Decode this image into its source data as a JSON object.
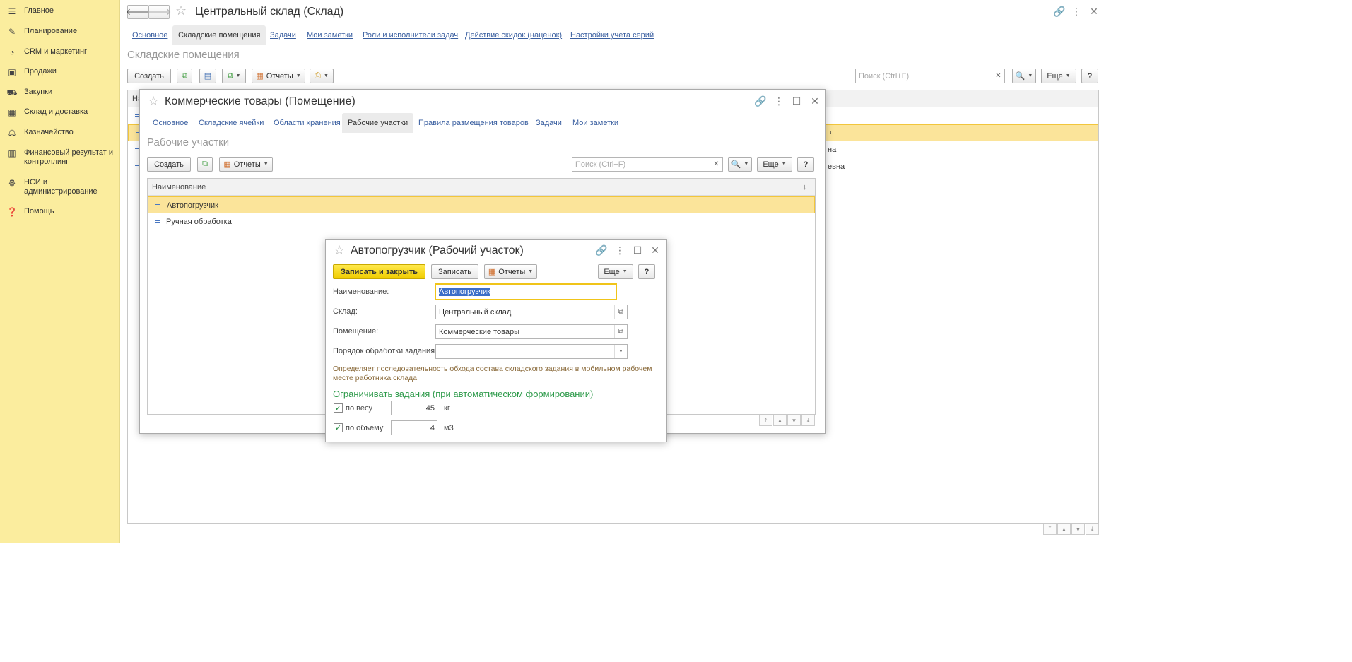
{
  "sidebar": {
    "items": [
      {
        "label": "Главное",
        "icon": "menu-icon"
      },
      {
        "label": "Планирование",
        "icon": "planning-icon"
      },
      {
        "label": "CRM и маркетинг",
        "icon": "crm-icon"
      },
      {
        "label": "Продажи",
        "icon": "sales-icon"
      },
      {
        "label": "Закупки",
        "icon": "cart-icon"
      },
      {
        "label": "Склад и доставка",
        "icon": "warehouse-icon"
      },
      {
        "label": "Казначейство",
        "icon": "treasury-icon"
      },
      {
        "label": "Финансовый результат и контроллинг",
        "icon": "chart-icon"
      },
      {
        "label": "НСИ и администрирование",
        "icon": "gear-icon"
      },
      {
        "label": "Помощь",
        "icon": "help-icon"
      }
    ]
  },
  "main": {
    "title": "Центральный склад (Склад)",
    "tabs": [
      "Основное",
      "Складские помещения",
      "Задачи",
      "Мои заметки",
      "Роли и исполнители задач",
      "Действие скидок (наценок)",
      "Настройки учета серий"
    ],
    "active_tab": "Складские помещения",
    "section_title": "Складские помещения",
    "toolbar": {
      "create": "Создать",
      "reports": "Отчеты",
      "more": "Еще",
      "help": "?"
    },
    "search_placeholder": "Поиск (Ctrl+F)",
    "grid": {
      "header_partial": "На",
      "row_fragments": [
        "ч",
        "на",
        "евна"
      ]
    }
  },
  "room_window": {
    "title": "Коммерческие товары (Помещение)",
    "tabs": [
      "Основное",
      "Складские ячейки",
      "Области хранения",
      "Рабочие участки",
      "Правила размещения товаров",
      "Задачи",
      "Мои заметки"
    ],
    "active_tab": "Рабочие участки",
    "section_title": "Рабочие участки",
    "toolbar": {
      "create": "Создать",
      "reports": "Отчеты",
      "more": "Еще",
      "help": "?"
    },
    "search_placeholder": "Поиск (Ctrl+F)",
    "grid": {
      "column": "Наименование",
      "sort_glyph": "↓",
      "rows": [
        "Автопогрузчик",
        "Ручная обработка"
      ]
    }
  },
  "workarea_window": {
    "title": "Автопогрузчик (Рабочий участок)",
    "toolbar": {
      "save_close": "Записать и закрыть",
      "save": "Записать",
      "reports": "Отчеты",
      "more": "Еще",
      "help": "?"
    },
    "fields": {
      "name_label": "Наименование:",
      "name_value": "Автопогрузчик",
      "warehouse_label": "Склад:",
      "warehouse_value": "Центральный склад",
      "room_label": "Помещение:",
      "room_value": "Коммерческие товары",
      "order_label": "Порядок обработки задания:",
      "order_value": ""
    },
    "hint": "Определяет последовательность обхода состава складского задания в мобильном рабочем месте работника склада.",
    "limits_title": "Ограничивать задания (при автоматическом формировании)",
    "limits": [
      {
        "label": "по весу",
        "value": "45",
        "unit": "кг",
        "checked": true
      },
      {
        "label": "по объему",
        "value": "4",
        "unit": "м3",
        "checked": true
      }
    ]
  }
}
